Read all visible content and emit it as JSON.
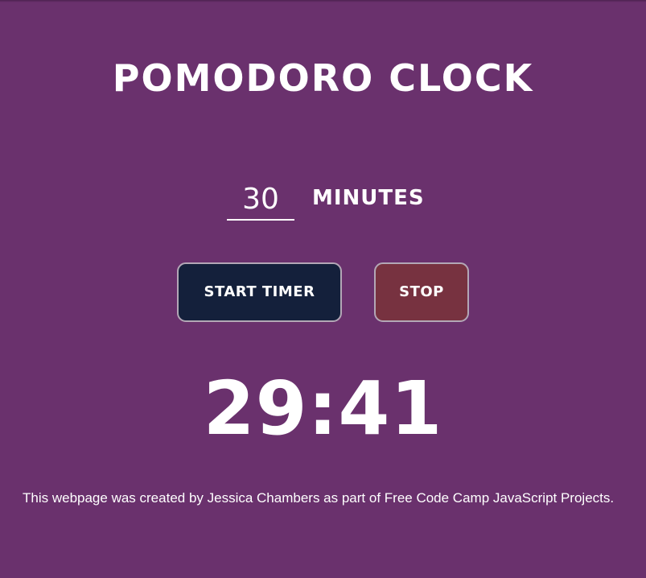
{
  "app": {
    "title": "POMODORO CLOCK"
  },
  "timer_setup": {
    "minutes_value": "30",
    "minutes_label": "MINUTES"
  },
  "controls": {
    "start_label": "START TIMER",
    "stop_label": "STOP"
  },
  "countdown": {
    "display": "29:41"
  },
  "footer": {
    "text": "This webpage was created by Jessica Chambers as part of Free Code Camp JavaScript Projects."
  },
  "colors": {
    "background": "#6a316d",
    "start_button": "#14203b",
    "stop_button": "#773240",
    "text": "#ffffff"
  }
}
